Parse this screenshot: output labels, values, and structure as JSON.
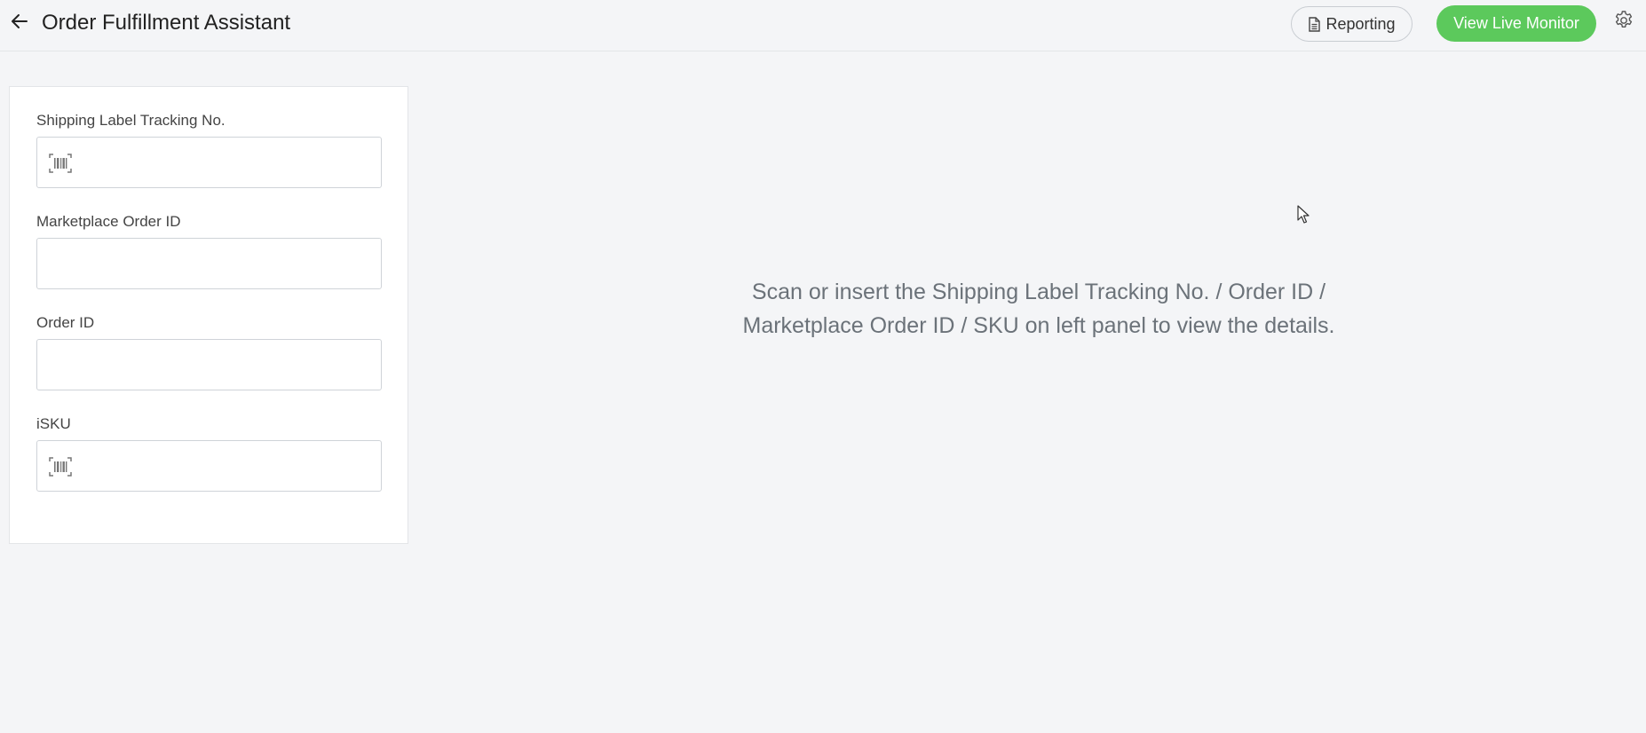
{
  "header": {
    "title": "Order Fulfillment Assistant",
    "reporting_label": "Reporting",
    "live_monitor_label": "View Live Monitor"
  },
  "form": {
    "fields": [
      {
        "label": "Shipping Label Tracking No.",
        "value": "",
        "icon": "barcode-icon"
      },
      {
        "label": "Marketplace Order ID",
        "value": ""
      },
      {
        "label": "Order ID",
        "value": ""
      },
      {
        "label": "iSKU",
        "value": "",
        "icon": "barcode-icon"
      }
    ]
  },
  "main": {
    "message_line1": "Scan or insert the Shipping Label Tracking No. / Order ID /",
    "message_line2": "Marketplace Order ID / SKU on left panel to view the details."
  },
  "colors": {
    "accent_green": "#5cc95c",
    "background": "#f4f5f7"
  }
}
